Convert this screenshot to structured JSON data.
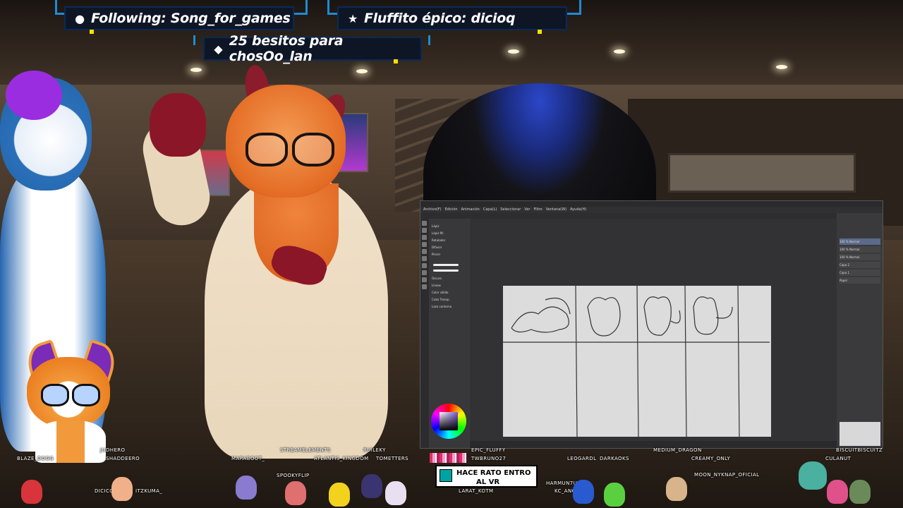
{
  "alerts": {
    "following": "Following: Song_for_games",
    "fluffito": "Fluffito épico: dicioq",
    "besitos": "25 besitos para chosOo_lan"
  },
  "app_window": {
    "menu": [
      "Archivo(F)",
      "Edición",
      "Animación",
      "Capa(L)",
      "Seleccionar",
      "Ver",
      "Filtro",
      "Ventana(W)",
      "Ayuda(H)"
    ],
    "subtool_rows": [
      "Lápiz",
      "Lápiz fill",
      "Rotulador",
      "Difusor",
      "Pincel",
      "Oscuro",
      "Líneas",
      "Color sólido",
      "Cubo Transp.",
      "Lazo contorno"
    ],
    "layers": [
      "100 % Normal",
      "100 % Normal",
      "100 % Normal",
      "Capa 2",
      "Capa 1",
      "Papel"
    ]
  },
  "chat_message": {
    "line1": "HACE RATO ENTRO",
    "line2": "AL VR"
  },
  "viewer_names": [
    "BLAZE_DOGG",
    "JUDHERO",
    "SHADDEERO",
    "MARABOOT_",
    "STREAMELEMENTS",
    "ATLANTIS_KINGDOM",
    "RUILEKY",
    "TOMETTERS",
    "SPOOKYFLIP",
    "DICICO",
    "ITZKUMA_",
    "EPIC_FLUFFY",
    "TWBRUNO27",
    "LARAT_KOTM",
    "LEOGARDL",
    "DARKAOKS",
    "HARMUN7U7",
    "KC_ANGLZZ",
    "MEDIUM_DRAGON",
    "CREAMY_ONLY",
    "MOON_NYKNAP_OFICIAL",
    "BISCUITBISCUITZ",
    "CULANUT"
  ],
  "colors": {
    "alert_bg": "#0e1626",
    "alert_frame": "#1f8bd2",
    "accent_yellow": "#ffe000"
  },
  "icons": {
    "following": "user-icon",
    "fluffito": "star-icon",
    "besitos": "diamond-icon"
  }
}
